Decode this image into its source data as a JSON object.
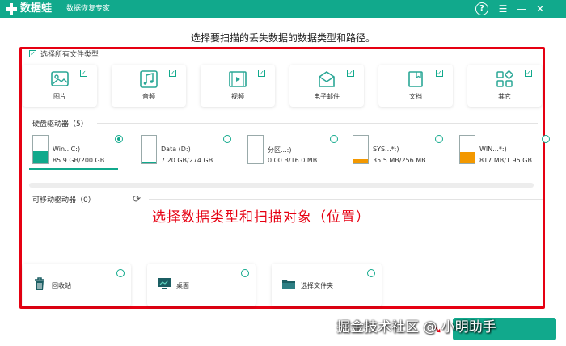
{
  "app": {
    "title": "数据蛙",
    "subtitle": "数据恢复专家"
  },
  "titlebar": {
    "help_icon": "?",
    "menu_icon": "☰",
    "min_icon": "—",
    "close_icon": "✕"
  },
  "heading": "选择要扫描的丢失数据的数据类型和路径。",
  "select_all": {
    "label": "选择所有文件类型",
    "checked": true
  },
  "file_types": [
    {
      "label": "图片",
      "icon": "image-icon",
      "checked": true
    },
    {
      "label": "音频",
      "icon": "music-icon",
      "checked": true
    },
    {
      "label": "视频",
      "icon": "video-icon",
      "checked": true
    },
    {
      "label": "电子邮件",
      "icon": "email-icon",
      "checked": true
    },
    {
      "label": "文档",
      "icon": "document-icon",
      "checked": true
    },
    {
      "label": "其它",
      "icon": "other-icon",
      "checked": true
    }
  ],
  "hard_drives": {
    "label": "硬盘驱动器（5）",
    "items": [
      {
        "name": "Win...C:)",
        "size": "85.9 GB/200 GB",
        "fill": 0.43,
        "color": "#11a98c",
        "selected": true
      },
      {
        "name": "Data (D:)",
        "size": "7.20 GB/274 GB",
        "fill": 0.03,
        "color": "#11a98c",
        "selected": false
      },
      {
        "name": "分区...:)",
        "size": "0.00  B/16.0 MB",
        "fill": 0.0,
        "color": "#f39800",
        "selected": false
      },
      {
        "name": "SYS...*:)",
        "size": "35.5 MB/256 MB",
        "fill": 0.14,
        "color": "#f39800",
        "selected": false
      },
      {
        "name": "WIN...*:)",
        "size": "817 MB/1.95 GB",
        "fill": 0.42,
        "color": "#f39800",
        "selected": false
      }
    ]
  },
  "removable": {
    "label": "可移动驱动器（0）",
    "refresh_icon": "⟳"
  },
  "annotation": "选择数据类型和扫描对象（位置）",
  "locations": [
    {
      "label": "回收站",
      "icon": "trash-icon"
    },
    {
      "label": "桌面",
      "icon": "desktop-icon"
    },
    {
      "label": "选择文件夹",
      "icon": "folder-icon"
    }
  ],
  "watermark": "掘金技术社区 @ 小明助手"
}
